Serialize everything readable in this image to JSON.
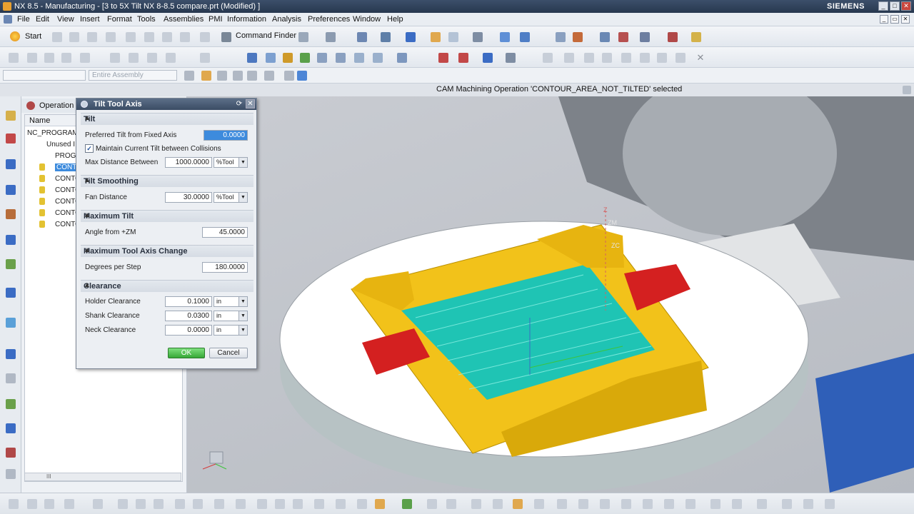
{
  "window": {
    "title": "NX 8.5 - Manufacturing - [3 to 5X Tilt NX 8-8.5 compare.prt (Modified) ]",
    "brand": "SIEMENS"
  },
  "menu": [
    "File",
    "Edit",
    "View",
    "Insert",
    "Format",
    "Tools",
    "Assemblies",
    "PMI",
    "Information",
    "Analysis",
    "Preferences",
    "Window",
    "Help"
  ],
  "toolbar": {
    "start_label": "Start",
    "command_finder_label": "Command Finder"
  },
  "selection_bar": {
    "filter_placeholder": "",
    "scope_value": "Entire Assembly"
  },
  "status": "CAM Machining Operation 'CONTOUR_AREA_NOT_TILTED' selected",
  "navigator": {
    "title": "Operation",
    "column_name": "Name",
    "rows": [
      "NC_PROGRAM",
      "Unused I",
      "PROGR",
      "CONTO",
      "CONTO",
      "CONTO",
      "CONTO",
      "CONTO",
      "CONTO"
    ],
    "scroll_indicator": "III"
  },
  "dialog": {
    "title": "Tilt Tool Axis",
    "reset_icon": "⟳",
    "close_icon": "✕",
    "sections": {
      "tilt": "Tilt",
      "tilt_smoothing": "Tilt Smoothing",
      "max_tilt": "Maximum Tilt",
      "max_axis_change": "Maximum Tool Axis Change",
      "clearance": "Clearance"
    },
    "fields": {
      "preferred_tilt_label": "Preferred Tilt from Fixed Axis",
      "preferred_tilt_value": "0.0000",
      "maintain_label": "Maintain Current Tilt between Collisions",
      "maintain_checked": true,
      "max_distance_label": "Max Distance Between",
      "max_distance_value": "1000.0000",
      "max_distance_unit": "%Tool",
      "fan_distance_label": "Fan Distance",
      "fan_distance_value": "30.0000",
      "fan_distance_unit": "%Tool",
      "angle_label": "Angle from +ZM",
      "angle_value": "45.0000",
      "degrees_label": "Degrees per Step",
      "degrees_value": "180.0000",
      "holder_label": "Holder Clearance",
      "holder_value": "0.1000",
      "holder_unit": "in",
      "shank_label": "Shank Clearance",
      "shank_value": "0.0300",
      "shank_unit": "in",
      "neck_label": "Neck Clearance",
      "neck_value": "0.0000",
      "neck_unit": "in"
    },
    "ok_label": "OK",
    "cancel_label": "Cancel"
  },
  "viewport": {
    "axis_labels": {
      "zm": "ZM",
      "zc": "ZC",
      "z": "Z"
    }
  },
  "colors": {
    "part_yellow": "#f2c21a",
    "clamp_red": "#d42020",
    "toolpath_cyan": "#1fc4b4",
    "table_white": "#ffffff",
    "fixture_gray": "#9aa0a6"
  }
}
